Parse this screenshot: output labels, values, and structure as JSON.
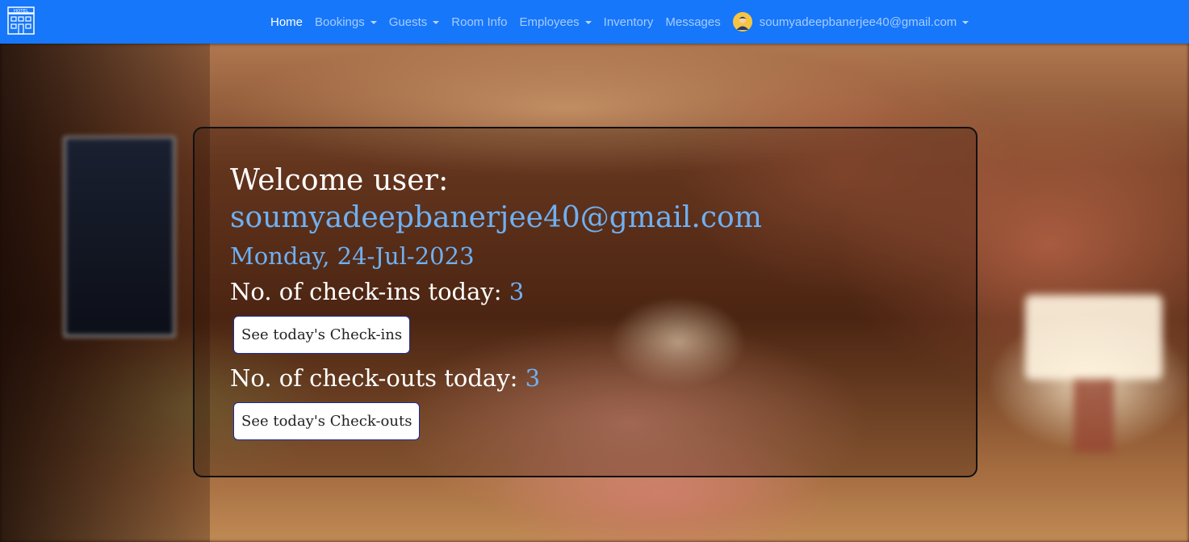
{
  "navbar": {
    "brand_text": "HOTEL",
    "items": [
      {
        "label": "Home",
        "active": true,
        "dropdown": false
      },
      {
        "label": "Bookings",
        "active": false,
        "dropdown": true
      },
      {
        "label": "Guests",
        "active": false,
        "dropdown": true
      },
      {
        "label": "Room Info",
        "active": false,
        "dropdown": false
      },
      {
        "label": "Employees",
        "active": false,
        "dropdown": true
      },
      {
        "label": "Inventory",
        "active": false,
        "dropdown": false
      },
      {
        "label": "Messages",
        "active": false,
        "dropdown": false
      }
    ],
    "user_email": "soumyadeepbanerjee40@gmail.com"
  },
  "card": {
    "welcome_label": "Welcome user:",
    "user_email": "soumyadeepbanerjee40@gmail.com",
    "date": "Monday, 24-Jul-2023",
    "checkins_label": "No. of check-ins today: ",
    "checkins_count": "3",
    "checkins_button": "See today's Check-ins",
    "checkouts_label": "No. of check-outs today: ",
    "checkouts_count": "3",
    "checkouts_button": "See today's Check-outs"
  },
  "colors": {
    "navbar": "#1677fb",
    "accent_text": "#6fb0f2"
  }
}
